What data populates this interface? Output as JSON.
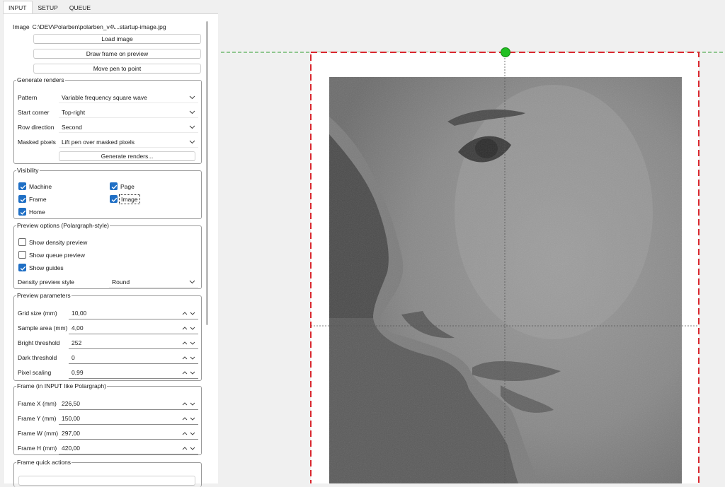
{
  "tabs": [
    "INPUT",
    "SETUP",
    "QUEUE"
  ],
  "image": {
    "label": "Image",
    "path": "C:\\DEV\\Polarben\\polarben_v4\\...startup-image.jpg"
  },
  "buttons": {
    "load_image": "Load image",
    "draw_frame": "Draw frame on preview",
    "move_pen": "Move pen to point"
  },
  "generate": {
    "title": "Generate renders",
    "pattern_label": "Pattern",
    "pattern_value": "Variable frequency square wave",
    "start_corner_label": "Start corner",
    "start_corner_value": "Top-right",
    "row_direction_label": "Row direction",
    "row_direction_value": "Second",
    "masked_label": "Masked pixels",
    "masked_value": "Lift pen over masked pixels",
    "button": "Generate renders..."
  },
  "visibility": {
    "title": "Visibility",
    "items": [
      {
        "label": "Machine",
        "checked": true
      },
      {
        "label": "Page",
        "checked": true
      },
      {
        "label": "Frame",
        "checked": true
      },
      {
        "label": "Image",
        "checked": true
      },
      {
        "label": "Home",
        "checked": true
      }
    ]
  },
  "preview_options": {
    "title": "Preview options (Polargraph-style)",
    "items": [
      {
        "label": "Show density preview",
        "checked": false
      },
      {
        "label": "Show queue preview",
        "checked": false
      },
      {
        "label": "Show guides",
        "checked": true
      }
    ],
    "style_label": "Density preview style",
    "style_value": "Round"
  },
  "preview_params": {
    "title": "Preview parameters",
    "fields": [
      {
        "label": "Grid size (mm)",
        "value": "10,00"
      },
      {
        "label": "Sample area (mm)",
        "value": "4,00"
      },
      {
        "label": "Bright threshold",
        "value": "252"
      },
      {
        "label": "Dark threshold",
        "value": "0"
      },
      {
        "label": "Pixel scaling",
        "value": "0,99"
      }
    ]
  },
  "frame": {
    "title": "Frame (in INPUT like Polargraph)",
    "fields": [
      {
        "label": "Frame X (mm)",
        "value": "226,50"
      },
      {
        "label": "Frame Y (mm)",
        "value": "150,00"
      },
      {
        "label": "Frame W (mm)",
        "value": "297,00"
      },
      {
        "label": "Frame H (mm)",
        "value": "420,00"
      }
    ]
  },
  "quick_actions": {
    "title": "Frame quick actions"
  },
  "colors": {
    "accent": "#1f6fc5",
    "frame_border": "#d9272e",
    "machine_line": "#2e9e2e",
    "pen_marker": "#22c022"
  },
  "icons": [
    "chevron-down-icon",
    "spin-up-down-icon",
    "checkmark-icon",
    "pen-position-marker"
  ]
}
